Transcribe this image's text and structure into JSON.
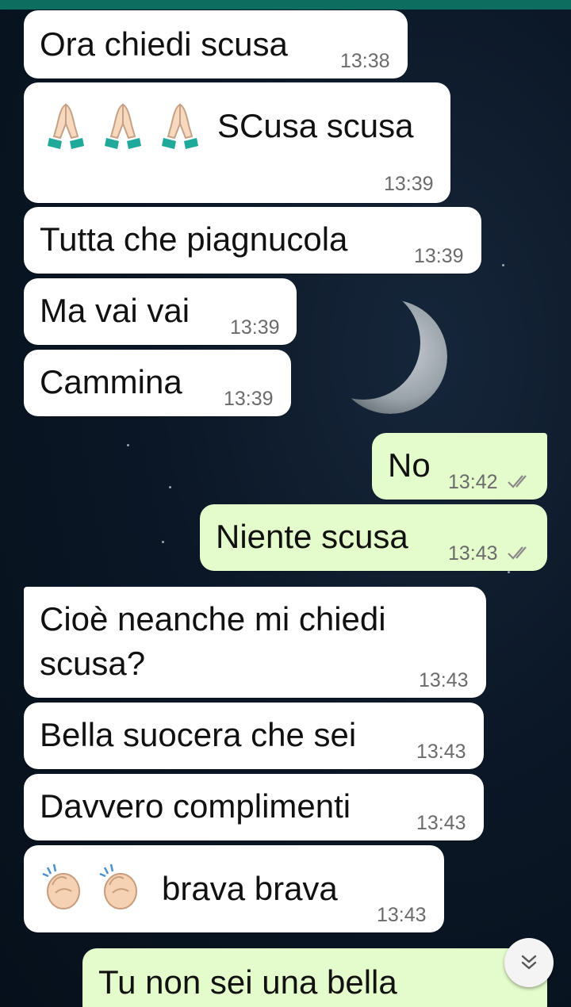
{
  "chat": {
    "messages": [
      {
        "text": "Ora chiedi scusa",
        "time": "13:38",
        "direction": "incoming"
      },
      {
        "emoji": "folded-hands x3",
        "text": "SCusa scusa",
        "time": "13:39",
        "direction": "incoming"
      },
      {
        "text": "Tutta che piagnucola",
        "time": "13:39",
        "direction": "incoming"
      },
      {
        "text": "Ma vai vai",
        "time": "13:39",
        "direction": "incoming"
      },
      {
        "text": "Cammina",
        "time": "13:39",
        "direction": "incoming"
      },
      {
        "text": "No",
        "time": "13:42",
        "direction": "outgoing",
        "status": "read"
      },
      {
        "text": "Niente scusa",
        "time": "13:43",
        "direction": "outgoing",
        "status": "read"
      },
      {
        "text_line1": "Cioè neanche mi chiedi",
        "text_line2": "scusa?",
        "time": "13:43",
        "direction": "incoming"
      },
      {
        "text": "Bella suocera che sei",
        "time": "13:43",
        "direction": "incoming"
      },
      {
        "text": "Davvero complimenti",
        "time": "13:43",
        "direction": "incoming"
      },
      {
        "emoji": "clapping-hands x2",
        "text": "brava brava",
        "time": "13:43",
        "direction": "incoming"
      },
      {
        "text": "Tu non sei una bella",
        "direction": "outgoing"
      }
    ]
  },
  "colors": {
    "incoming_bubble": "#ffffff",
    "outgoing_bubble": "#e4fccb",
    "header_bar": "#0d6e5f",
    "timestamp": "#6b6b6b",
    "read_check": "#8a8a8a"
  },
  "icons": {
    "scroll_down": "double-chevron-down-icon",
    "read_receipt": "double-check-icon",
    "wallpaper_moon": "crescent-moon"
  }
}
